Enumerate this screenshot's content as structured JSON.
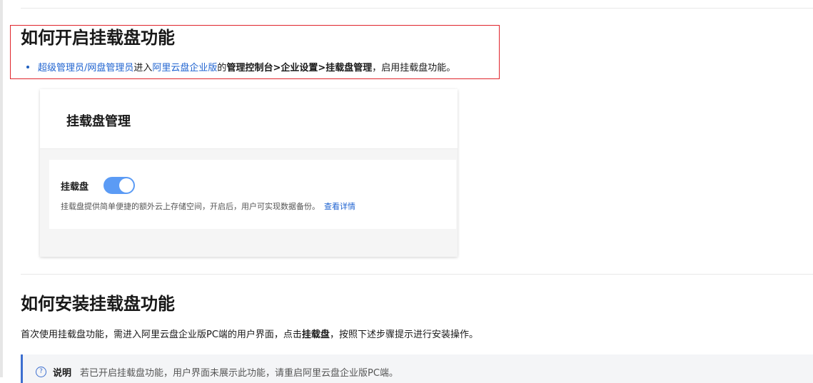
{
  "section1": {
    "title": "如何开启挂载盘功能",
    "bullet": {
      "role_link": "超级管理员/网盘管理员",
      "text_enter": "进入",
      "product_link": "阿里云盘企业版",
      "text_of": "的",
      "path_console": "管理控制台",
      "sep1": ">",
      "path_settings": "企业设置",
      "sep2": ">",
      "path_mount": "挂载盘管理",
      "tail": "，启用挂载盘功能。"
    }
  },
  "screenshot": {
    "title": "挂载盘管理",
    "toggle_label": "挂载盘",
    "toggle_on": true,
    "desc": "挂载盘提供简单便捷的额外云上存储空间，开启后，用户可实现数据备份。",
    "detail_link": "查看详情"
  },
  "section2": {
    "title": "如何安装挂载盘功能",
    "para_pre": "首次使用挂载盘功能，需进入阿里云盘企业版PC端的用户界面，点击",
    "para_bold": "挂载盘",
    "para_post": "，按照下述步骤提示进行安装操作。"
  },
  "note": {
    "icon": "question-circle-icon",
    "label": "说明",
    "text": "若已开启挂载盘功能，用户界面未展示此功能，请重启阿里云盘企业版PC端。"
  },
  "colors": {
    "link": "#1f63d0",
    "highlight_border": "#e0242b",
    "toggle_on": "#5b9bf5"
  }
}
